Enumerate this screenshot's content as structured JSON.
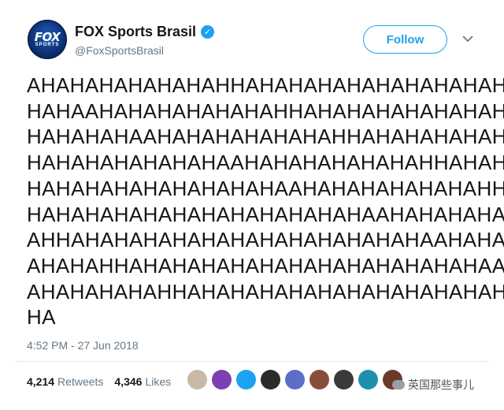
{
  "account": {
    "display_name": "FOX Sports Brasil",
    "handle": "@FoxSportsBrasil",
    "avatar_text": "FOX",
    "avatar_subtext": "SPORTS",
    "verified_glyph": "✓"
  },
  "follow_label": "Follow",
  "tweet": {
    "lines": [
      "AHAHAHAHAHAHAHHAHAHAHAHAHAHAHAHAHA",
      "HAHAAHAHAHAHAHAHAHHAHAHAHAHAHAHAHA",
      "HAHAHAHAAHAHAHAHAHAHAHHAHAHAHAHAHA",
      "HAHAHAHAHAHAHAAHAHAHAHAHAHAHHAHAHA",
      "HAHAHAHAHAHAHAHAHAAHAHAHAHAHAHAHHA",
      "HAHAHAHAHAHAHAHAHAHAHAHAAHAHAHAHAH",
      "AHHAHAHAHAHAHAHAHAHAHAHAHAHAAHAHAH",
      "AHAHAHHAHAHAHAHAHAHAHAHAHAHAHAHAAH",
      "AHAHAHAHAHHAHAHAHAHAHAHAHAHAHAHAHA",
      "HA"
    ],
    "timestamp": "4:52 PM - 27 Jun 2018"
  },
  "stats": {
    "retweets_count": "4,214",
    "retweets_label": "Retweets",
    "likes_count": "4,346",
    "likes_label": "Likes"
  },
  "liker_colors": [
    "#c9b8a6",
    "#7a3fb0",
    "#1da1f2",
    "#2b2b2b",
    "#5b6fc9",
    "#8a4d3a",
    "#3a3a3a",
    "#1f8fb0",
    "#6b3a2a"
  ],
  "watermark_text": "英国那些事儿"
}
